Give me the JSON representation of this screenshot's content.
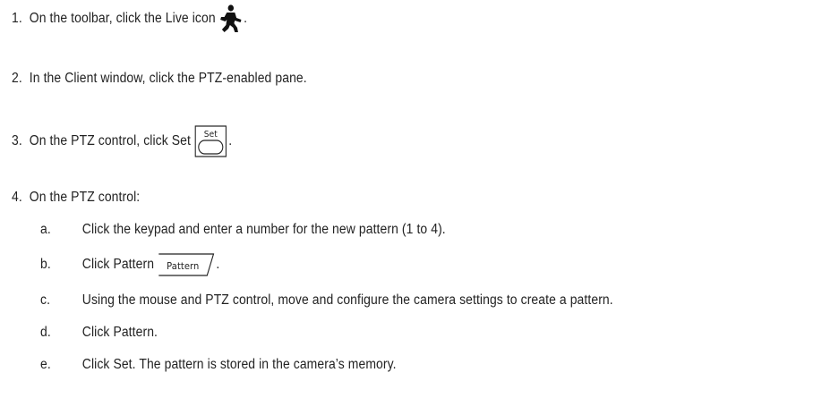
{
  "steps": [
    {
      "num": "1.",
      "text": "On the toolbar, click the Live icon",
      "icon": "walking-person-icon",
      "suffix": "."
    },
    {
      "num": "2.",
      "text": "In the Client window, click the PTZ-enabled pane.",
      "icon": "",
      "suffix": ""
    },
    {
      "num": "3.",
      "text": "On the PTZ control, click Set",
      "icon": "set-button-icon",
      "icon_label": "Set",
      "suffix": "."
    },
    {
      "num": "4.",
      "text": "On the PTZ control:",
      "icon": "",
      "suffix": ""
    }
  ],
  "substeps": [
    {
      "letter": "a.",
      "text": "Click the keypad and enter a number for the new pattern (1 to 4).",
      "suffix": ""
    },
    {
      "letter": "b.",
      "text": "Click Pattern",
      "icon": "pattern-button-icon",
      "icon_label": "Pattern",
      "suffix": "."
    },
    {
      "letter": "c.",
      "text": "Using the mouse and PTZ control, move and configure the camera settings to create a pattern.",
      "suffix": ""
    },
    {
      "letter": "d.",
      "text": "Click Pattern.",
      "suffix": ""
    },
    {
      "letter": "e.",
      "text": "Click Set. The pattern is stored in the camera’s memory.",
      "suffix": ""
    }
  ]
}
